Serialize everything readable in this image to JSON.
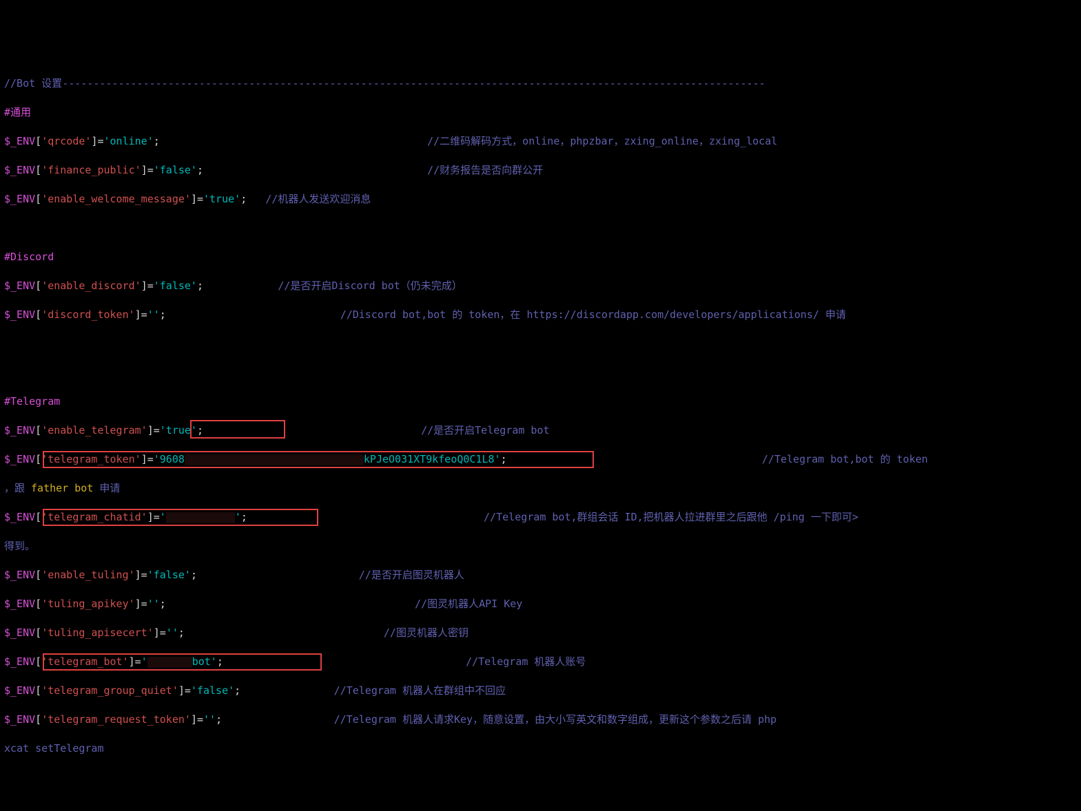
{
  "header": {
    "title": "//Bot 设置",
    "dashes": "-----------------------------------------------------------------------------------------------------------------"
  },
  "sections": {
    "general": "#通用",
    "discord": "#Discord",
    "telegram": "#Telegram"
  },
  "lines": {
    "qrcode": {
      "var": "$_ENV",
      "key": "'qrcode'",
      "val": "'online'",
      "comment": "//二维码解码方式，online，phpzbar，zxing_online，zxing_local"
    },
    "finance_public": {
      "var": "$_ENV",
      "key": "'finance_public'",
      "val": "'false'",
      "comment": "//财务报告是否向群公开"
    },
    "enable_welcome_message": {
      "var": "$_ENV",
      "key": "'enable_welcome_message'",
      "val": "'true'",
      "comment": "//机器人发送欢迎消息"
    },
    "enable_discord": {
      "var": "$_ENV",
      "key": "'enable_discord'",
      "val": "'false'",
      "comment": "//是否开启Discord bot（仍未完成）"
    },
    "discord_token": {
      "var": "$_ENV",
      "key": "'discord_token'",
      "val": "''",
      "comment": "//Discord bot,bot 的 token，在 https://discordapp.com/developers/applications/ 申请"
    },
    "enable_telegram": {
      "var": "$_ENV",
      "key": "'enable_telegram'",
      "val": "'true'",
      "comment": "//是否开启Telegram bot"
    },
    "telegram_token": {
      "var": "$_ENV",
      "key": "'telegram_token'",
      "val_prefix": "'9608",
      "val_suffix": "kPJeO031XT9kfeoQ0C1L8'",
      "comment": "//Telegram bot,bot 的 token",
      "cont_prefix": "，跟 ",
      "cont_link": "father bot",
      "cont_suffix": " 申请"
    },
    "telegram_chatid": {
      "var": "$_ENV",
      "key": "'telegram_chatid'",
      "val_prefix": "'",
      "val_suffix": "'",
      "comment": "//Telegram bot,群组会话 ID,把机器人拉进群里之后跟他 /ping 一下即可>",
      "cont": "得到。"
    },
    "enable_tuling": {
      "var": "$_ENV",
      "key": "'enable_tuling'",
      "val": "'false'",
      "comment": "//是否开启图灵机器人"
    },
    "tuling_apikey": {
      "var": "$_ENV",
      "key": "'tuling_apikey'",
      "val": "''",
      "comment": "//图灵机器人API Key"
    },
    "tuling_apisecert": {
      "var": "$_ENV",
      "key": "'tuling_apisecert'",
      "val": "''",
      "comment": "//图灵机器人密钥"
    },
    "telegram_bot": {
      "var": "$_ENV",
      "key": "'telegram_bot'",
      "val_prefix": "'",
      "val_suffix": "bot'",
      "comment": "//Telegram 机器人账号"
    },
    "telegram_group_quiet": {
      "var": "$_ENV",
      "key": "'telegram_group_quiet'",
      "val": "'false'",
      "comment": "//Telegram 机器人在群组中不回应"
    },
    "telegram_request_token": {
      "var": "$_ENV",
      "key": "'telegram_request_token'",
      "val": "''",
      "comment": "//Telegram 机器人请求Key，随意设置，由大小写英文和数字组成，更新这个参数之后请 php ",
      "cont": "xcat setTelegram"
    }
  }
}
